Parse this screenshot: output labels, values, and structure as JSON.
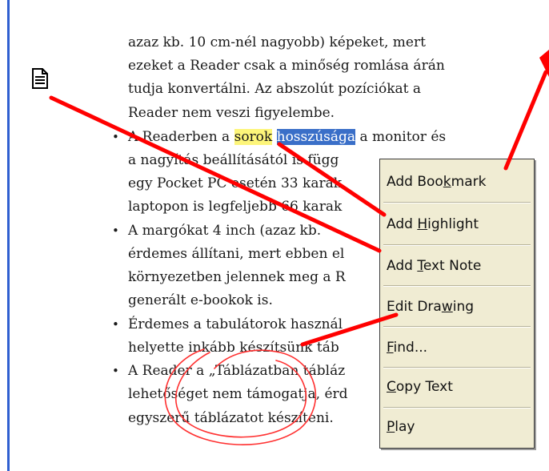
{
  "document": {
    "lines": [
      {
        "text": "azaz kb. 10 cm-nél nagyobb) képeket, mert"
      },
      {
        "text": "ezeket a Reader csak a minőség romlása árán"
      },
      {
        "text": "tudja konvertálni. Az abszolút pozíciókat a"
      },
      {
        "text": "Reader nem veszi figyelembe."
      },
      {
        "bullet": "•",
        "pre": "A Readerben a ",
        "hl": "sorok",
        "space": " ",
        "sel": "hosszúsága",
        "post": " a monitor és"
      },
      {
        "text": "a nagyítás beállításától is függ"
      },
      {
        "text": "egy Pocket PC esetén 33 karak"
      },
      {
        "text": "laptopon is legfeljebb 66 karak"
      },
      {
        "bullet": "•",
        "text": "A margókat 4 inch (azaz kb."
      },
      {
        "text": "érdemes állítani, mert ebben el"
      },
      {
        "text": "környezetben jelennek meg a R"
      },
      {
        "text": "generált e-bookok is."
      },
      {
        "bullet": "•",
        "text": "Érdemes a tabulátorok használ"
      },
      {
        "text": "helyette inkább készítsünk táb"
      },
      {
        "bullet": "•",
        "text": "A Reader a „Táblázatban tábláz"
      },
      {
        "text": "lehetőséget nem támogatja, érd"
      },
      {
        "text": "egyszerű táblázatot készíteni."
      }
    ]
  },
  "context_menu": {
    "items": [
      {
        "pre": "Add Boo",
        "acc": "k",
        "post": "mark"
      },
      {
        "pre": "Add ",
        "acc": "H",
        "post": "ighlight"
      },
      {
        "pre": "Add ",
        "acc": "T",
        "post": "ext Note"
      },
      {
        "pre": "Edit Dra",
        "acc": "w",
        "post": "ing"
      },
      {
        "pre": "",
        "acc": "F",
        "post": "ind..."
      },
      {
        "pre": "",
        "acc": "C",
        "post": "opy Text"
      },
      {
        "pre": "",
        "acc": "P",
        "post": "lay"
      }
    ]
  },
  "icons": {
    "note": "note-icon"
  },
  "colors": {
    "ink": "#ff0000",
    "highlight": "#fdf57a",
    "selection": "#3a6fc8",
    "menu_bg": "#f0ecd3"
  }
}
